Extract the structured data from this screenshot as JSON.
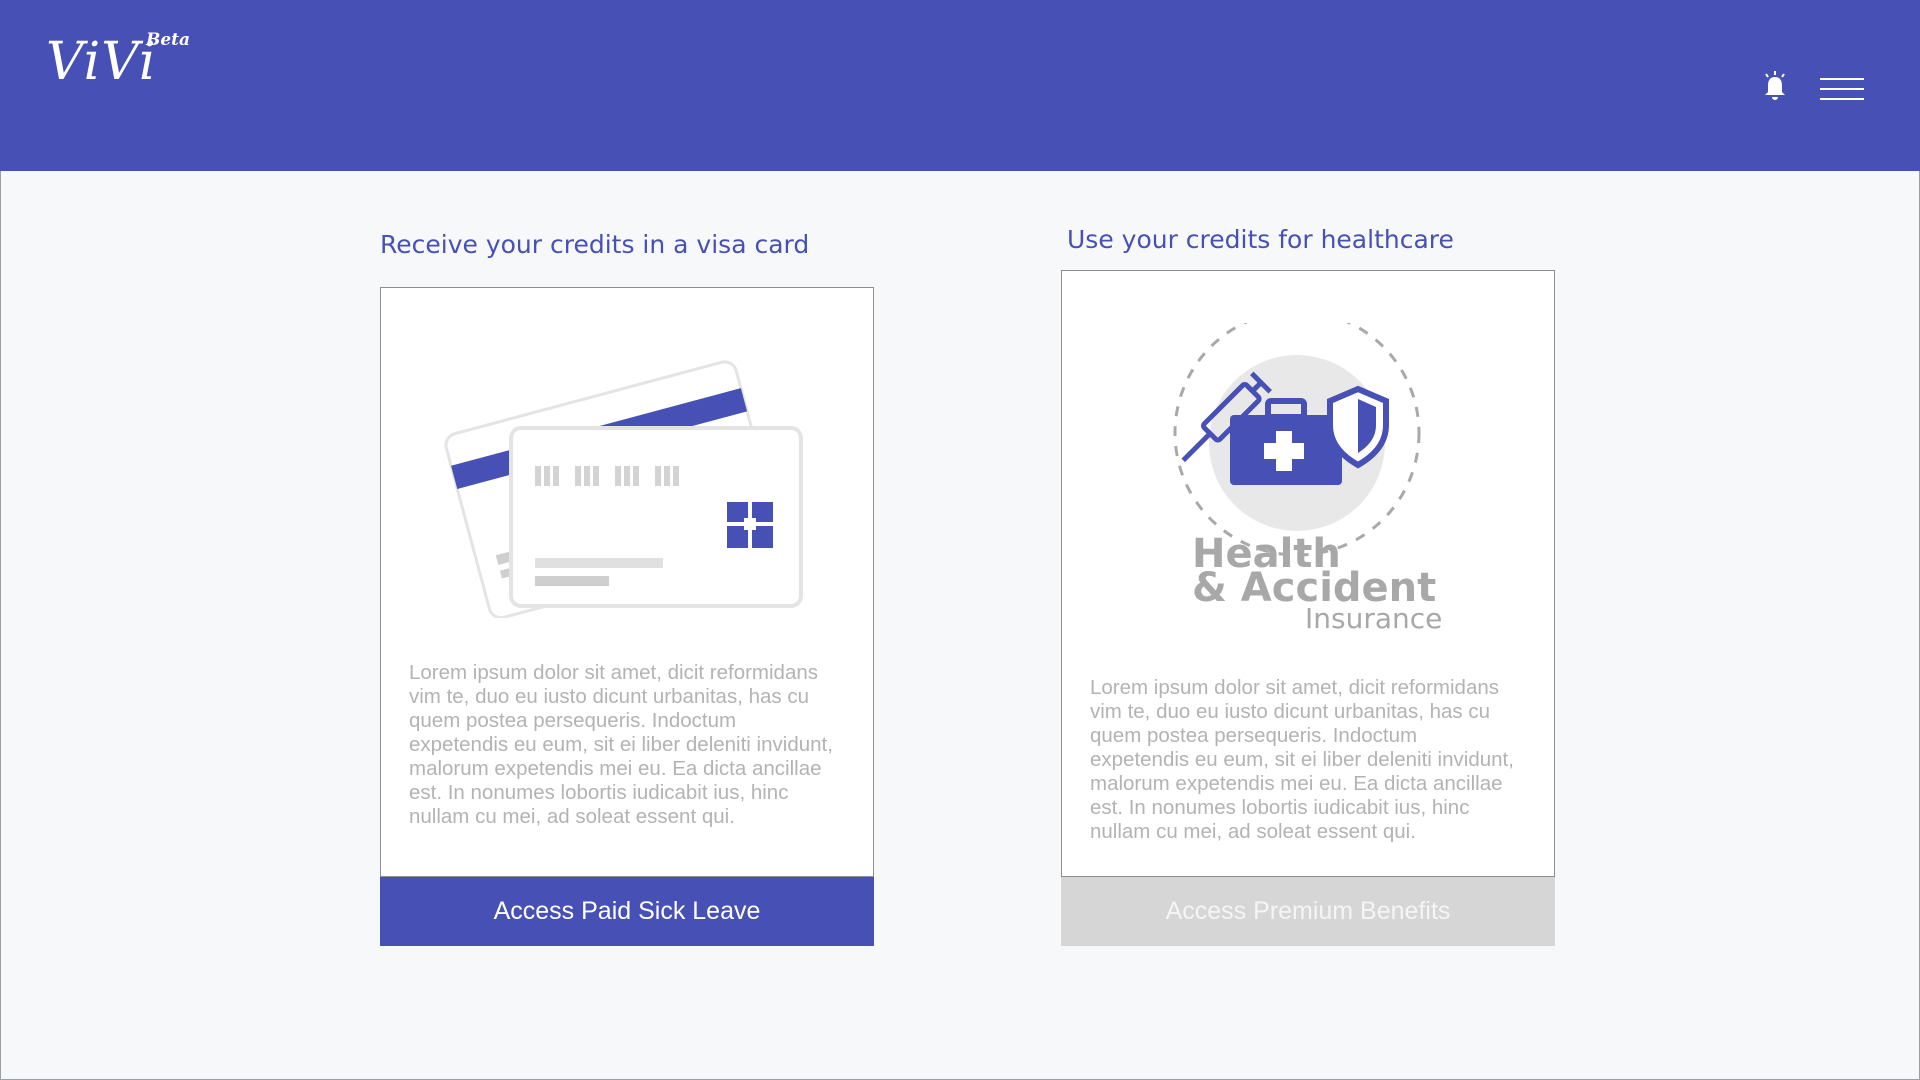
{
  "header": {
    "logo_text": "ViVi",
    "beta_label": "Beta",
    "icons": [
      "bell-icon",
      "hamburger-menu-icon"
    ],
    "background_color": "#4750b5"
  },
  "cards": [
    {
      "title": "Receive your credits in a visa card",
      "illustration": "credit-cards-illustration",
      "body": "Lorem ipsum dolor sit amet, dicit reformidans\nvim te, duo eu iusto dicunt urbanitas, has cu\nquem  postea persequeris. Indoctum\nexpetendis eu eum, sit ei liber deleniti invidunt,\nmalorum expetendis mei eu. Ea dicta ancillae\nest. In nonumes lobortis iudicabit ius, hinc\nnullam cu mei, ad soleat essent qui.",
      "button_label": "Access Paid Sick Leave",
      "button_state": "enabled"
    },
    {
      "title": "Use your credits for healthcare",
      "illustration": "health-insurance-illustration",
      "logo_line1": "Health",
      "logo_line2": "& Accident",
      "logo_line3": "Insurance",
      "body": "Lorem ipsum dolor sit amet, dicit reformidans\nvim te, duo eu iusto dicunt urbanitas, has cu\nquem  postea persequeris. Indoctum\nexpetendis eu eum, sit ei liber deleniti invidunt,\nmalorum expetendis mei eu. Ea dicta ancillae\nest. In nonumes lobortis iudicabit ius, hinc\nnullam cu mei, ad soleat essent qui.",
      "button_label": "Access Premium Benefits",
      "button_state": "disabled"
    }
  ],
  "colors": {
    "accent": "#4750b5",
    "disabled_button": "#d6d6d6",
    "body_text": "#b3b3b3"
  }
}
